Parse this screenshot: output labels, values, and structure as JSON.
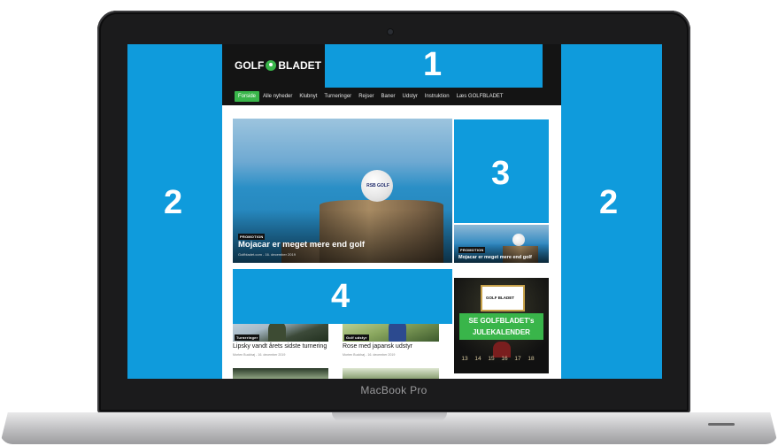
{
  "device": {
    "label": "MacBook Pro"
  },
  "site": {
    "logo": {
      "left": "GOLF",
      "right": "BLADET"
    },
    "nav": [
      "Forside",
      "Alle nyheder",
      "Klubnyt",
      "Turneringer",
      "Rejser",
      "Baner",
      "Udstyr",
      "Instruktion",
      "Læs GOLFBLADET"
    ],
    "nav_active": "Forside",
    "hero": {
      "ball_text": "RSB GOLF",
      "badge": "PROMOTION",
      "title": "Mojacar er meget mere end golf",
      "meta": "Golfbladet.com - 16. december 2019"
    },
    "side_small": {
      "badge": "PROMOTION",
      "title": "Mojacar er meget mere end golf"
    },
    "cards": [
      {
        "badge": "Turneringer",
        "title": "Lipsky vandt årets sidste turnering",
        "meta": "Morten Buckhøj - 16. december 2019"
      },
      {
        "badge": "Golf udstyr",
        "title": "Rose med japansk udstyr",
        "meta": "Morten Buckhøj - 16. december 2019"
      }
    ],
    "ad": {
      "frame_text": "GOLF BLADET",
      "line1": "SE GOLFBLADET's",
      "line2": "JULEKALENDER",
      "numbers": [
        "13",
        "14",
        "15",
        "16",
        "17",
        "18"
      ]
    }
  },
  "zones": [
    {
      "id": "1",
      "label": "1"
    },
    {
      "id": "2a",
      "label": "2"
    },
    {
      "id": "2b",
      "label": "2"
    },
    {
      "id": "3",
      "label": "3"
    },
    {
      "id": "4",
      "label": "4"
    }
  ],
  "colors": {
    "zone_blue": "#0f9bdc",
    "brand_green": "#39b54a"
  }
}
